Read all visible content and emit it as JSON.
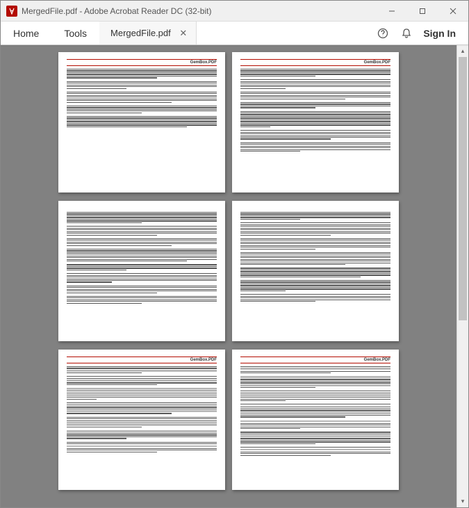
{
  "window": {
    "title": "MergedFile.pdf - Adobe Acrobat Reader DC (32-bit)"
  },
  "toolbar": {
    "home": "Home",
    "tools": "Tools",
    "doctab": "MergedFile.pdf",
    "signin": "Sign In"
  },
  "pageheader": "GemBox.PDF"
}
